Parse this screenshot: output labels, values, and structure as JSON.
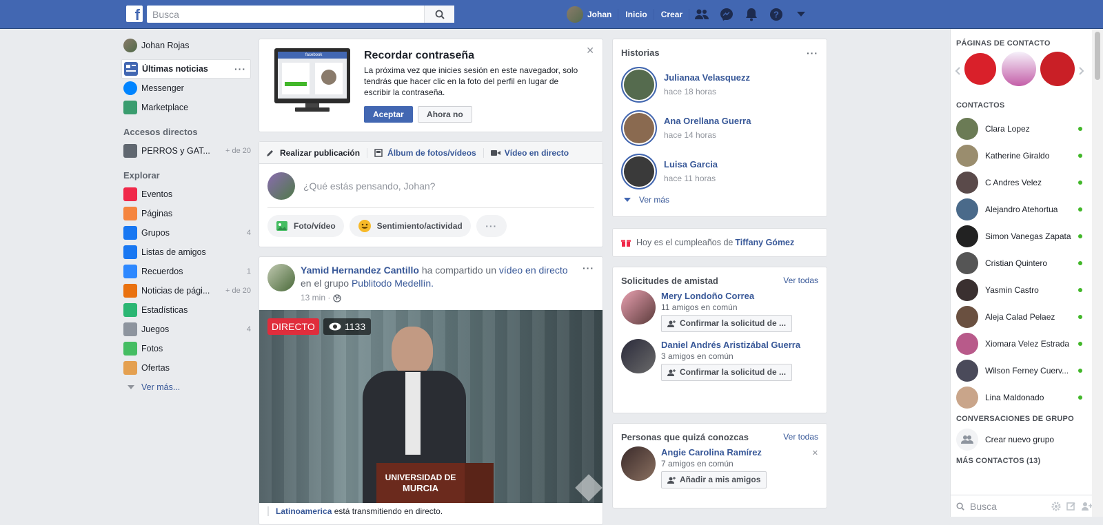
{
  "topbar": {
    "search_placeholder": "Busca",
    "user_name": "Johan",
    "home": "Inicio",
    "create": "Crear"
  },
  "left": {
    "profile": "Johan Rojas",
    "items": [
      {
        "label": "Últimas noticias",
        "icon": "newsfeed-icon",
        "color": "#4267b2"
      },
      {
        "label": "Messenger",
        "icon": "messenger-icon",
        "color": "#0084ff"
      },
      {
        "label": "Marketplace",
        "icon": "marketplace-icon",
        "color": "#3a9d6f"
      }
    ],
    "shortcuts_title": "Accesos directos",
    "shortcuts": [
      {
        "label": "PERROS y GAT...",
        "count": "+ de 20"
      }
    ],
    "explore_title": "Explorar",
    "explore": [
      {
        "label": "Eventos",
        "count": "",
        "icon": "calendar-icon",
        "color": "#f02849"
      },
      {
        "label": "Páginas",
        "count": "",
        "icon": "flag-icon",
        "color": "#f5853f"
      },
      {
        "label": "Grupos",
        "count": "4",
        "icon": "groups-icon",
        "color": "#1877f2"
      },
      {
        "label": "Listas de amigos",
        "count": "",
        "icon": "friend-list-icon",
        "color": "#1877f2"
      },
      {
        "label": "Recuerdos",
        "count": "1",
        "icon": "clock-icon",
        "color": "#2d88ff"
      },
      {
        "label": "Noticias de pági...",
        "count": "+ de 20",
        "icon": "page-news-icon",
        "color": "#e9710f"
      },
      {
        "label": "Estadísticas",
        "count": "",
        "icon": "stats-icon",
        "color": "#2bb673"
      },
      {
        "label": "Juegos",
        "count": "4",
        "icon": "gamepad-icon",
        "color": "#8d949e"
      },
      {
        "label": "Fotos",
        "count": "",
        "icon": "photos-icon",
        "color": "#45bd62"
      },
      {
        "label": "Ofertas",
        "count": "",
        "icon": "offers-icon",
        "color": "#e4a050"
      }
    ],
    "see_more": "Ver más..."
  },
  "password": {
    "title": "Recordar contraseña",
    "text": "La próxima vez que inicies sesión en este navegador, solo tendrás que hacer clic en la foto del perfil en lugar de escribir la contraseña.",
    "accept": "Aceptar",
    "decline": "Ahora no",
    "monitor_logo": "facebook"
  },
  "composer": {
    "tab_post": "Realizar publicación",
    "tab_album": "Álbum de fotos/vídeos",
    "tab_live": "Vídeo en directo",
    "placeholder": "¿Qué estás pensando, Johan?",
    "photo": "Foto/vídeo",
    "feeling": "Sentimiento/actividad"
  },
  "post": {
    "author": "Yamid Hernandez Cantillo",
    "shared": " ha compartido un ",
    "shared_link": "vídeo en directo",
    "in_group": "en el grupo ",
    "group": "Publitodo Medellín.",
    "time": "13 min ·",
    "live": "DIRECTO",
    "viewers": "1133",
    "podium_line1": "UNIVERSIDAD DE",
    "podium_line2": "MURCIA",
    "footer_link": "Latinoamerica",
    "footer_text": " está transmitiendo en directo."
  },
  "stories": {
    "title": "Historias",
    "items": [
      {
        "name": "Julianaa Velasquezz",
        "time": "hace 18 horas"
      },
      {
        "name": "Ana Orellana Guerra",
        "time": "hace 14 horas"
      },
      {
        "name": "Luisa Garcia",
        "time": "hace 11 horas"
      }
    ],
    "see_more": "Ver más"
  },
  "birthday": {
    "text": "Hoy es el cumpleaños de ",
    "name": "Tiffany Gómez"
  },
  "requests": {
    "title": "Solicitudes de amistad",
    "see_all": "Ver todas",
    "items": [
      {
        "name": "Mery Londoño Correa",
        "mutual": "11 amigos en común",
        "button": "Confirmar la solicitud de ..."
      },
      {
        "name": "Daniel Andrés Aristizábal Guerra",
        "mutual": "3 amigos en común",
        "button": "Confirmar la solicitud de ..."
      }
    ]
  },
  "pymk": {
    "title": "Personas que quizá conozcas",
    "see_all": "Ver todas",
    "name": "Angie Carolina Ramírez",
    "mutual": "7 amigos en común",
    "button": "Añadir a mis amigos"
  },
  "chat": {
    "pages_title": "PÁGINAS DE CONTACTO",
    "contacts_title": "CONTACTOS",
    "contacts": [
      {
        "name": "Clara Lopez",
        "color": "#6b7b55"
      },
      {
        "name": "Katherine Giraldo",
        "color": "#9a8d6e"
      },
      {
        "name": "C Andres Velez",
        "color": "#5a4a4a"
      },
      {
        "name": "Alejandro Atehortua",
        "color": "#4a6a8a"
      },
      {
        "name": "Simon Vanegas Zapata",
        "color": "#222222"
      },
      {
        "name": "Cristian Quintero",
        "color": "#555555"
      },
      {
        "name": "Yasmin Castro",
        "color": "#3a3030"
      },
      {
        "name": "Aleja Calad Pelaez",
        "color": "#6a5040"
      },
      {
        "name": "Xiomara Velez Estrada",
        "color": "#b85a8a"
      },
      {
        "name": "Wilson Ferney Cuerv...",
        "color": "#4a4a5a"
      },
      {
        "name": "Lina Maldonado",
        "color": "#c9a58a"
      }
    ],
    "group_title": "CONVERSACIONES DE GRUPO",
    "new_group": "Crear nuevo grupo",
    "more_contacts": "MÁS CONTACTOS (13)",
    "search_placeholder": "Busca"
  }
}
